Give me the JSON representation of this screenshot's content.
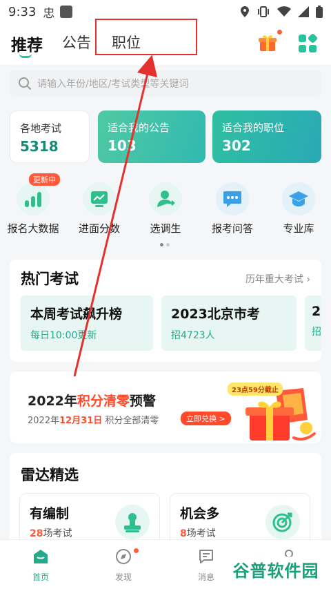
{
  "status_bar": {
    "time": "9:33",
    "app_glyph": "忠"
  },
  "header": {
    "tabs": [
      {
        "label": "推荐"
      },
      {
        "label": "公告"
      },
      {
        "label": "职位"
      }
    ]
  },
  "search": {
    "placeholder": "请输入年份/地区/考试类型等关键词"
  },
  "stats": [
    {
      "label": "各地考试",
      "value": "5318"
    },
    {
      "label": "适合我的公告",
      "value": "103"
    },
    {
      "label": "适合我的职位",
      "value": "302"
    }
  ],
  "quick_badge": "更新中",
  "quick": [
    {
      "label": "报名大数据",
      "icon": "bar-chart-icon"
    },
    {
      "label": "进面分数",
      "icon": "line-chart-icon"
    },
    {
      "label": "选调生",
      "icon": "user-swap-icon"
    },
    {
      "label": "报考问答",
      "icon": "chat-icon"
    },
    {
      "label": "专业库",
      "icon": "graduation-cap-icon"
    }
  ],
  "hot": {
    "title": "热门考试",
    "more": "历年重大考试",
    "cards": [
      {
        "title": "本周考试飙升榜",
        "sub": "每日10:00更新"
      },
      {
        "title": "2023北京市考",
        "sub": "招4723人"
      },
      {
        "title": "2",
        "sub": "招"
      }
    ]
  },
  "banner": {
    "title_a": "2022年",
    "title_b": "积分清零",
    "title_c": "预警",
    "sub_a": "2022年",
    "sub_date": "12月31日",
    "sub_b": " 积分全部清零",
    "button": "立即兑换 >",
    "tag": "23点59分截止"
  },
  "radar": {
    "title": "雷达精选",
    "cards": [
      {
        "title": "有编制",
        "count": "28",
        "unit": "场考试",
        "icon": "stamp-icon"
      },
      {
        "title": "机会多",
        "count": "8",
        "unit": "场考试",
        "icon": "target-icon"
      }
    ]
  },
  "nav": [
    {
      "label": "首页",
      "icon": "home-icon"
    },
    {
      "label": "发现",
      "icon": "compass-icon"
    },
    {
      "label": "消息",
      "icon": "message-icon"
    },
    {
      "label": "",
      "icon": "user-icon"
    }
  ],
  "watermark": "谷普软件园",
  "colors": {
    "accent": "#26c49a",
    "red": "#e5312d",
    "alert": "#ff5a3c"
  }
}
